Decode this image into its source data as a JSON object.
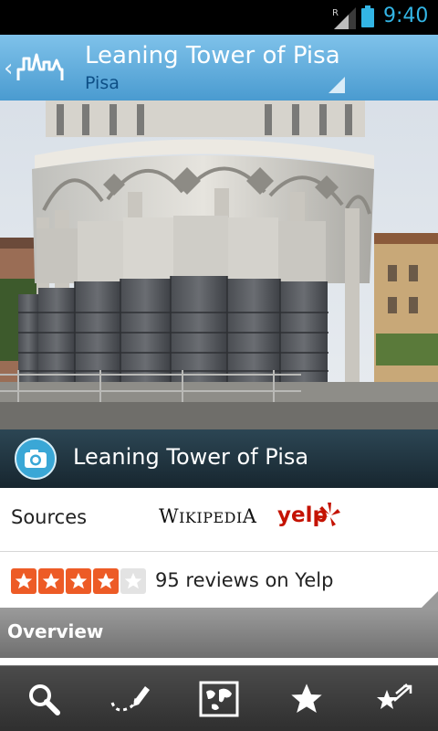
{
  "status_bar": {
    "time": "9:40",
    "roaming": "R",
    "icons": [
      "signal-icon",
      "battery-icon"
    ]
  },
  "action_bar": {
    "title": "Leaning Tower of Pisa",
    "subtitle": "Pisa",
    "icons": [
      "back-chevron-icon",
      "app-logo-icon"
    ],
    "accent_color": "#4a9bd0"
  },
  "caption": {
    "title": "Leaning Tower of Pisa",
    "icon": "camera-icon"
  },
  "sources": {
    "label": "Sources",
    "wikipedia_logo": "Wikipedia",
    "yelp_logo": "yelp"
  },
  "rating": {
    "stars": 4,
    "max_stars": 5,
    "reviews_text": "95 reviews on Yelp",
    "star_color": "#ed5b26"
  },
  "overview": {
    "label": "Overview"
  },
  "toolbar": {
    "items": [
      "search-icon",
      "route-icon",
      "map-icon",
      "favorites-icon",
      "nearby-icon"
    ]
  }
}
